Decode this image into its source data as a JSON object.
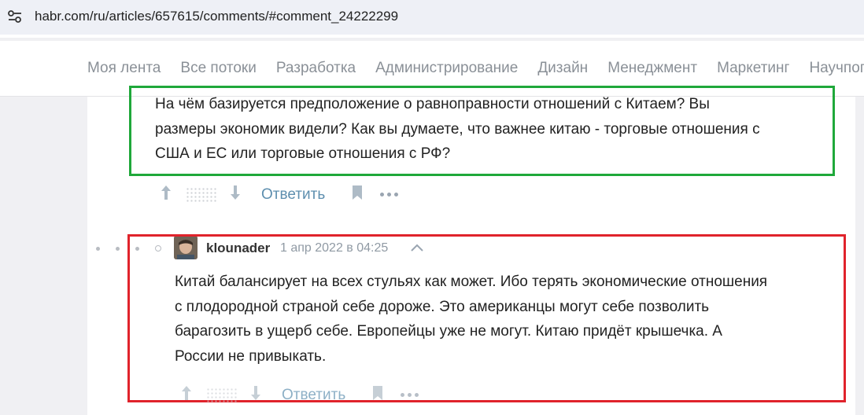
{
  "browser": {
    "url": "habr.com/ru/articles/657615/comments/#comment_24222299",
    "site_info_icon": "tune-icon"
  },
  "nav": {
    "items": [
      {
        "label": "Моя лента"
      },
      {
        "label": "Все потоки"
      },
      {
        "label": "Разработка"
      },
      {
        "label": "Администрирование"
      },
      {
        "label": "Дизайн"
      },
      {
        "label": "Менеджмент"
      },
      {
        "label": "Маркетинг"
      },
      {
        "label": "Научпоп"
      }
    ]
  },
  "comments": [
    {
      "lines": [
        "На чём базируется предположение о равноправности отношений с Китаем? Вы",
        "размеры экономик видели? Как вы думаете, что важнее китаю - торговые отношения с",
        "США и ЕС или торговые отношения с РФ?"
      ],
      "reply_label": "Ответить"
    },
    {
      "author": "klounader",
      "date": "1 апр 2022 в 04:25",
      "lines": [
        "Китай балансирует на всех стульях как может. Ибо терять экономические отношения",
        "с плодородной страной себе дороже. Это американцы могут себе позволить",
        "барагозить в ущерб себе. Европейцы уже не могут. Китаю придёт крышечка. А",
        "России не привыкать."
      ],
      "reply_label": "Ответить"
    }
  ],
  "colors": {
    "highlight_green": "#1fa83a",
    "highlight_red": "#e0232b",
    "reply_link": "#5e8faf"
  }
}
